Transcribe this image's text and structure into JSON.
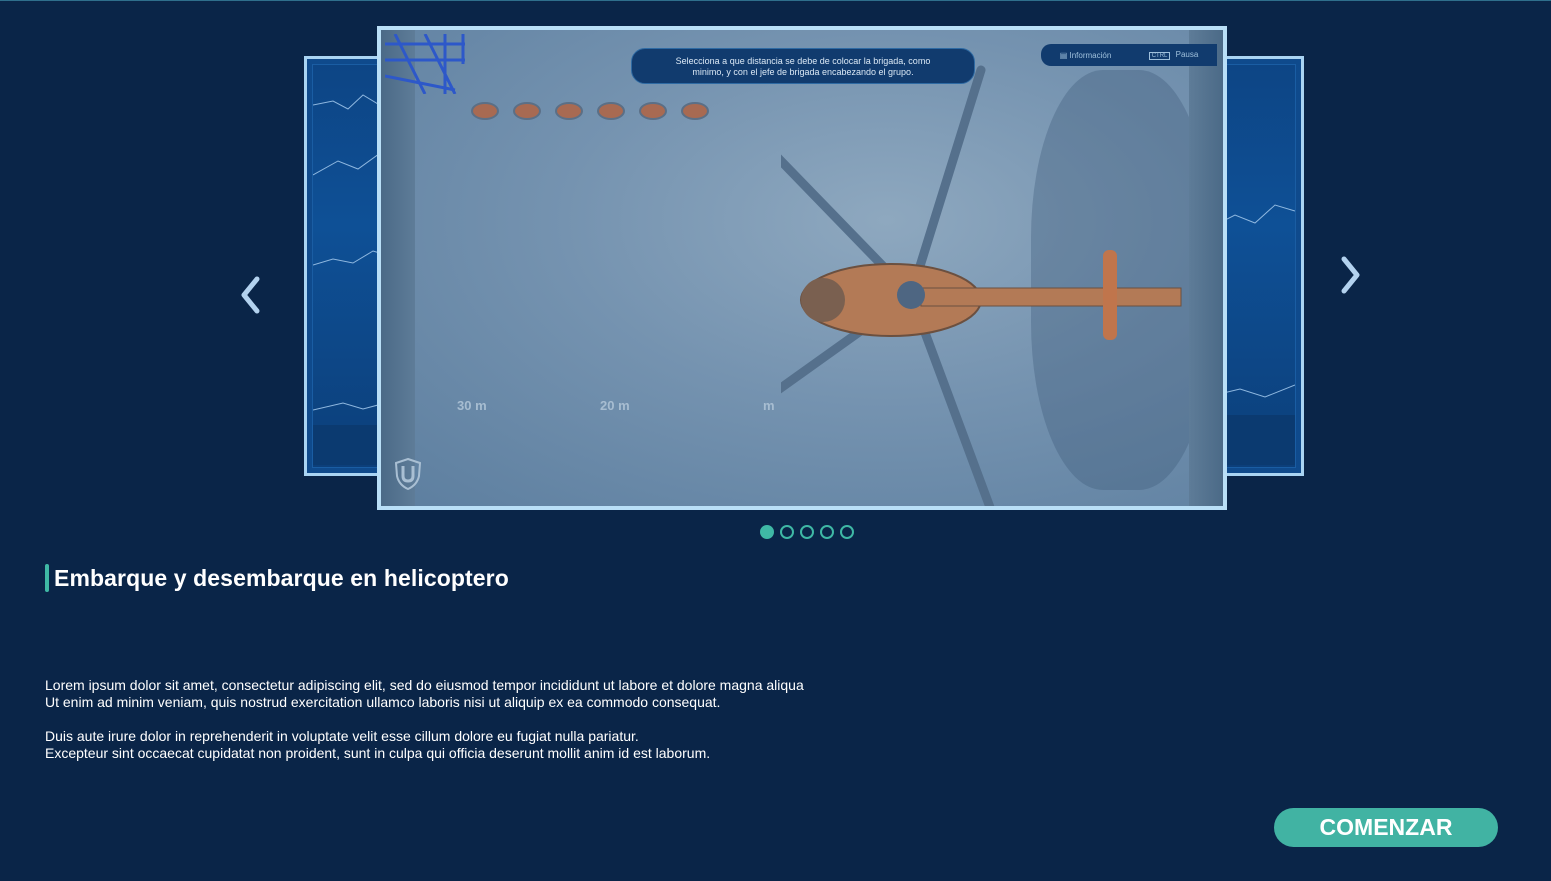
{
  "carousel": {
    "slide": {
      "instruction_line1": "Selecciona a que distancia se debe de colocar la brigada, como",
      "instruction_line2": "minimo, y con el jefe de brigada encabezando el grupo.",
      "info_label": "Información",
      "pause_key": "CTRL",
      "pause_label": "Pausa",
      "distance_labels": [
        "30 m",
        "20 m",
        "m"
      ]
    },
    "dots_total": 5,
    "active_dot": 1
  },
  "content": {
    "title": "Embarque y desembarque en helicoptero",
    "paragraph1_line1": "Lorem ipsum dolor sit amet, consectetur adipiscing elit, sed do eiusmod tempor incididunt ut labore et dolore magna aliqua",
    "paragraph1_line2": "Ut enim ad minim veniam, quis nostrud exercitation ullamco laboris nisi ut aliquip ex ea commodo consequat.",
    "paragraph2_line1": "Duis aute irure dolor in reprehenderit in voluptate velit esse cillum dolore eu fugiat nulla pariatur.",
    "paragraph2_line2": "Excepteur sint occaecat cupidatat non proident, sunt in culpa qui officia deserunt mollit anim id est laborum."
  },
  "actions": {
    "start_label": "COMENZAR"
  },
  "colors": {
    "background": "#0a2548",
    "accent": "#41b3a3",
    "frame": "#b9dff7"
  },
  "icons": {
    "prev": "chevron-left-icon",
    "next": "chevron-right-icon",
    "shield": "shield-icon",
    "info": "clipboard-icon"
  }
}
